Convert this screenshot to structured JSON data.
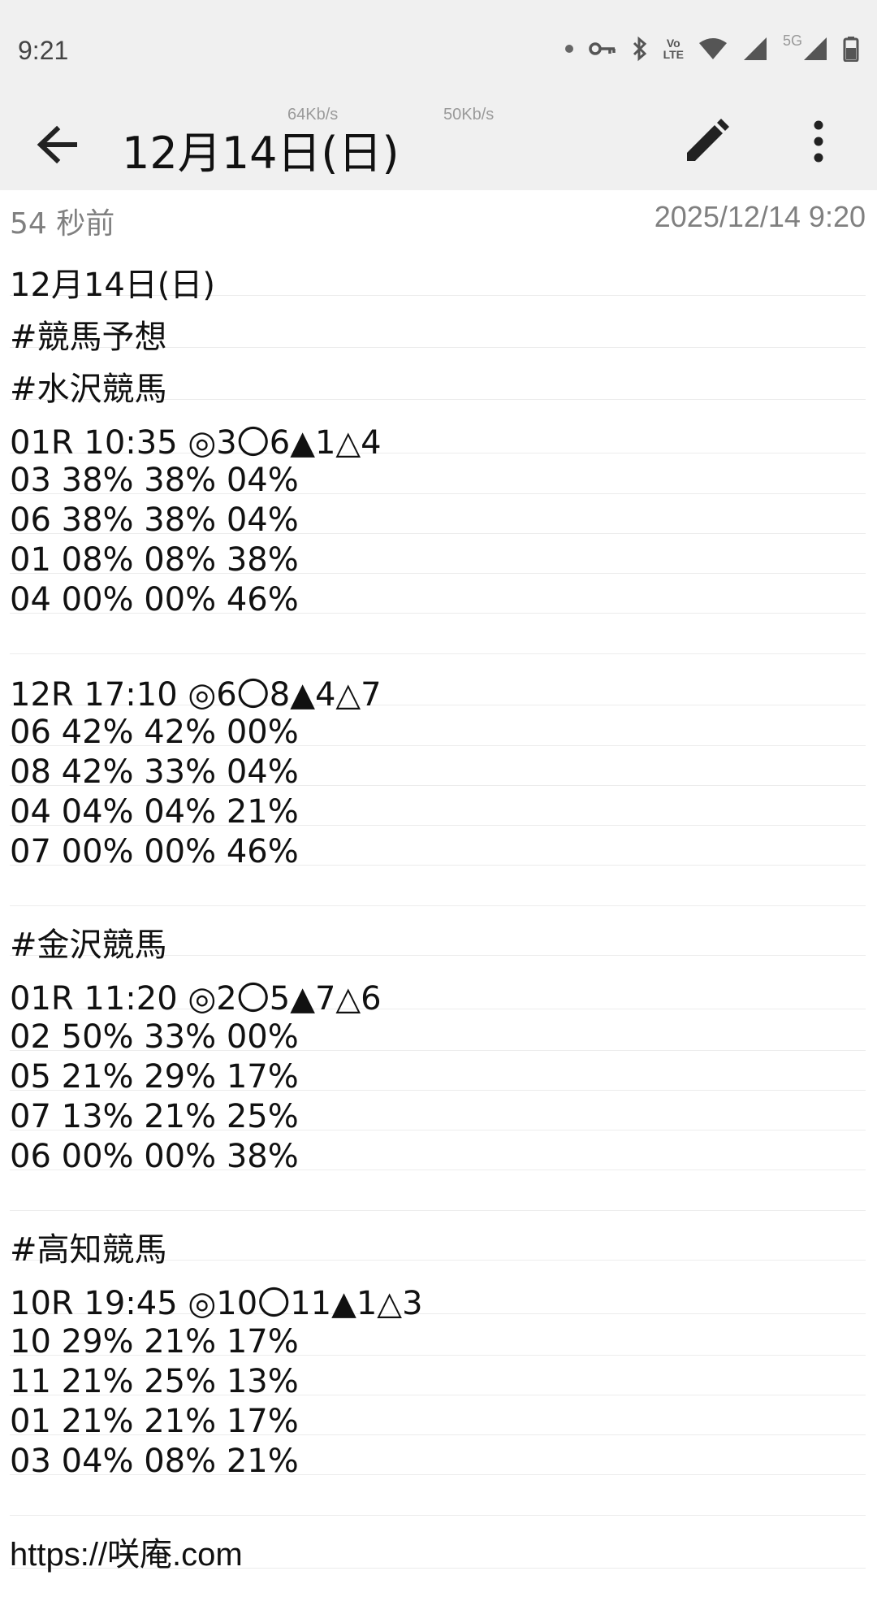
{
  "status_bar": {
    "time": "9:21",
    "icons": [
      "dot-icon",
      "vpn-key-icon",
      "bluetooth-icon",
      "volte-icon",
      "wifi-icon",
      "signal-icon",
      "5g-signal-icon",
      "battery-icon"
    ],
    "volte_label_top": "Vo",
    "volte_label_bottom": "LTE",
    "fiveg_label": "5G"
  },
  "app_bar": {
    "title": "12月14日(日)",
    "speed_1": "64Kb/s",
    "speed_2": "50Kb/s",
    "back_icon": "arrow-back-icon",
    "edit_icon": "pencil-icon",
    "more_icon": "more-vertical-icon"
  },
  "meta": {
    "relative_time": "54 秒前",
    "datetime": "2025/12/14 9:20"
  },
  "note_lines": [
    "12月14日(日)",
    "#競馬予想",
    "#水沢競馬",
    "01R 10:35 ◎3〇6▲1△4",
    "03 38% 38% 04%",
    "06 38% 38% 04%",
    "01 08% 08% 38%",
    "04 00% 00% 46%",
    "",
    "12R 17:10 ◎6〇8▲4△7",
    "06 42% 42% 00%",
    "08 42% 33% 04%",
    "04 04% 04% 21%",
    "07 00% 00% 46%",
    "",
    "#金沢競馬",
    "01R 11:20 ◎2〇5▲7△6",
    "02 50% 33% 00%",
    "05 21% 29% 17%",
    "07 13% 21% 25%",
    "06 00% 00% 38%",
    "",
    "#高知競馬",
    "10R 19:45 ◎10〇11▲1△3",
    "10 29% 21% 17%",
    "11 21% 25% 13%",
    "01 21% 21% 17%",
    "03 04% 08% 21%",
    "",
    "https://咲庵.com"
  ]
}
